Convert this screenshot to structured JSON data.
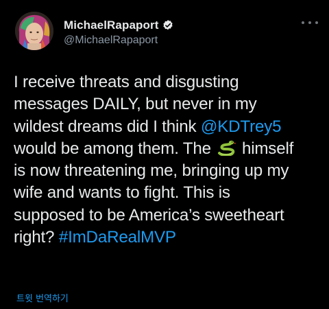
{
  "author": {
    "display_name": "MichaelRapaport",
    "handle": "@MichaelRapaport",
    "verified": true
  },
  "icons": {
    "verified": "verified-badge-icon",
    "more": "more-options-icon",
    "emoji": "snake-emoji-icon"
  },
  "tweet": {
    "line1": "I receive threats and disgusting",
    "line2": "messages DAILY, but never in my",
    "line3_text": "wildest dreams did I think ",
    "mention": "@KDTrey5",
    "line4_before": "would be among them. The",
    "line4_after": "himself",
    "line5": "is now threatening me, bringing up my",
    "line6": "wife and wants to fight. This is",
    "line7": "supposed to be America’s sweetheart",
    "line8_text": "right? ",
    "hashtag": "#ImDaRealMVP"
  },
  "translate_label": "트윗 번역하기",
  "colors": {
    "background": "#000000",
    "text": "#e7e9ea",
    "secondary": "#8b98a5",
    "link": "#1d9bf0"
  }
}
